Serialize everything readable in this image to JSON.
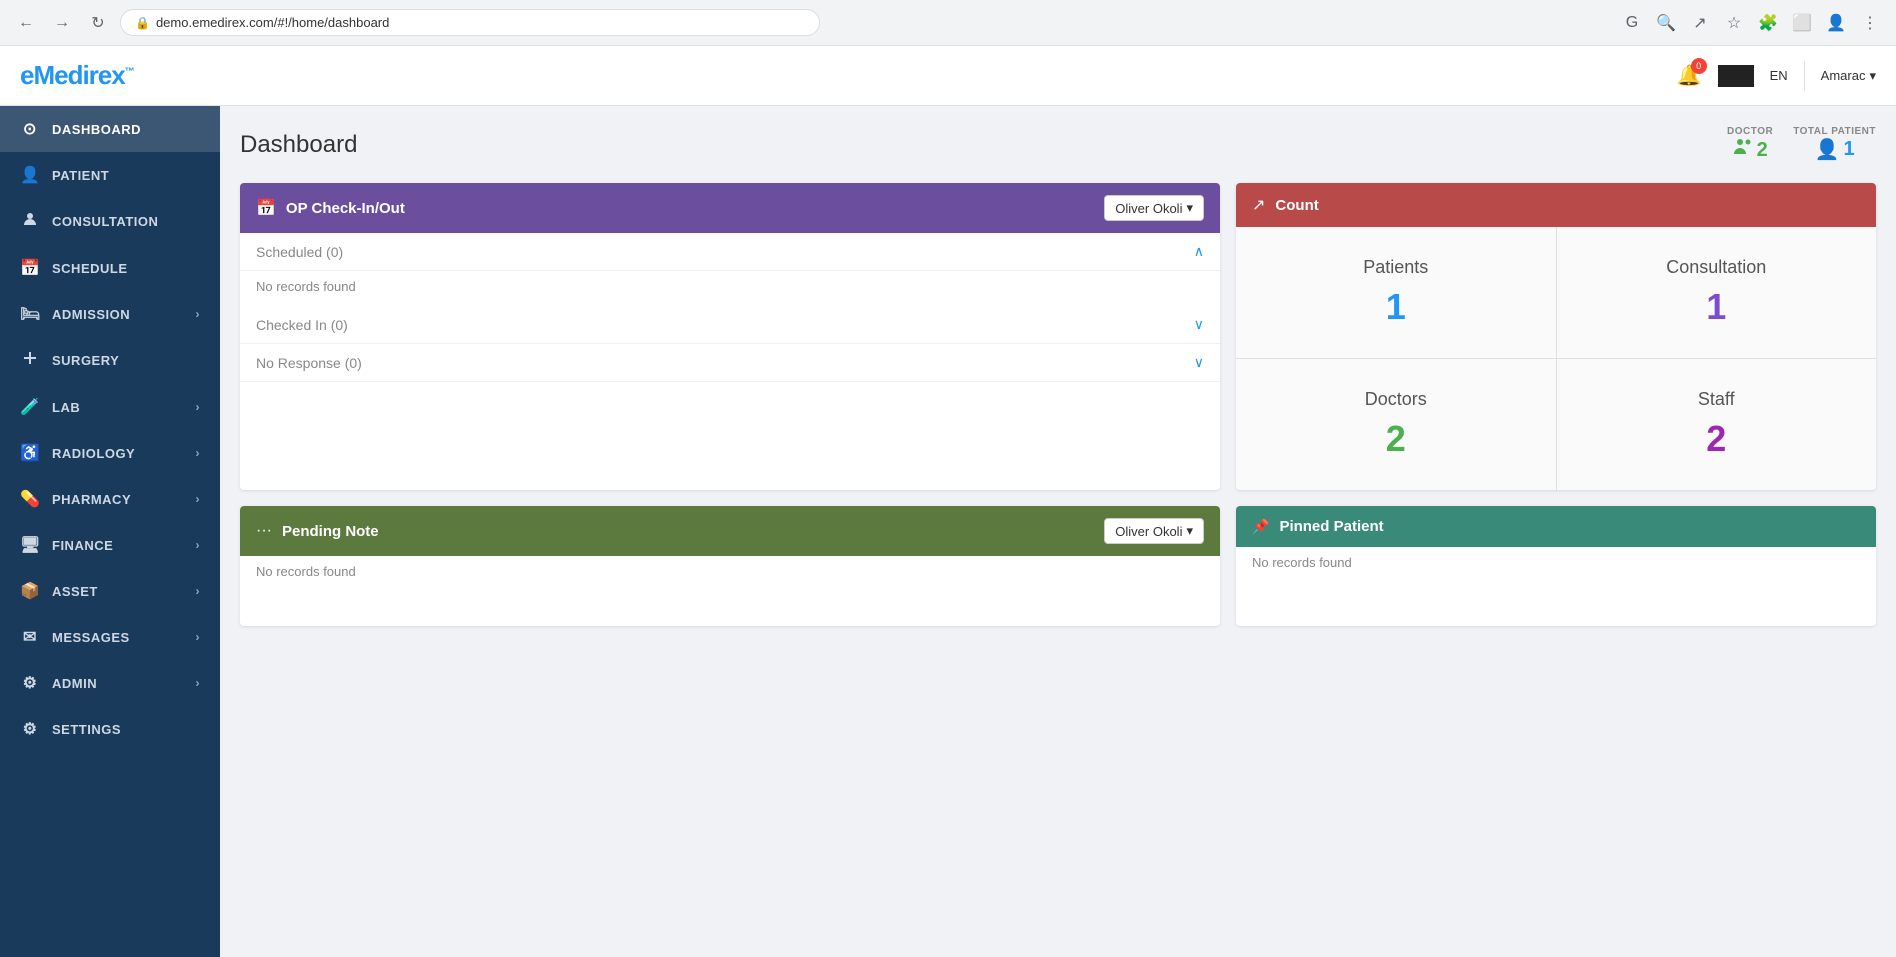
{
  "browser": {
    "url": "demo.emedirex.com/#!/home/dashboard",
    "nav": {
      "back": "←",
      "forward": "→",
      "reload": "↻"
    }
  },
  "header": {
    "logo": "eMedirex",
    "logo_tm": "™",
    "notification_count": "0",
    "language": "EN",
    "user": "Amarac"
  },
  "sidebar": {
    "items": [
      {
        "id": "dashboard",
        "label": "DASHBOARD",
        "icon": "⊙",
        "hasChevron": false,
        "active": true
      },
      {
        "id": "patient",
        "label": "PATIENT",
        "icon": "👤",
        "hasChevron": false,
        "active": false
      },
      {
        "id": "consultation",
        "label": "CONSULTATION",
        "icon": "👤",
        "hasChevron": false,
        "active": false
      },
      {
        "id": "schedule",
        "label": "SCHEDULE",
        "icon": "📅",
        "hasChevron": false,
        "active": false
      },
      {
        "id": "admission",
        "label": "ADMISSION",
        "icon": "🛏",
        "hasChevron": true,
        "active": false
      },
      {
        "id": "surgery",
        "label": "SURGERY",
        "icon": "🔧",
        "hasChevron": false,
        "active": false
      },
      {
        "id": "lab",
        "label": "LAB",
        "icon": "🧪",
        "hasChevron": true,
        "active": false
      },
      {
        "id": "radiology",
        "label": "RADIOLOGY",
        "icon": "♿",
        "hasChevron": true,
        "active": false
      },
      {
        "id": "pharmacy",
        "label": "PHARMACY",
        "icon": "💊",
        "hasChevron": true,
        "active": false
      },
      {
        "id": "finance",
        "label": "FINANCE",
        "icon": "🖥",
        "hasChevron": true,
        "active": false
      },
      {
        "id": "asset",
        "label": "ASSET",
        "icon": "📦",
        "hasChevron": true,
        "active": false
      },
      {
        "id": "messages",
        "label": "MESSAGES",
        "icon": "✉",
        "hasChevron": true,
        "active": false
      },
      {
        "id": "admin",
        "label": "ADMIN",
        "icon": "⚙",
        "hasChevron": true,
        "active": false
      },
      {
        "id": "settings",
        "label": "SETTINGS",
        "icon": "⚙",
        "hasChevron": false,
        "active": false
      }
    ]
  },
  "dashboard": {
    "title": "Dashboard",
    "stats": {
      "doctor_label": "DOCTOR",
      "doctor_value": "2",
      "patient_label": "TOTAL PATIENT",
      "patient_value": "1"
    },
    "op_checkin": {
      "header": "OP Check-In/Out",
      "doctor_select": "Oliver Okoli",
      "sections": [
        {
          "label": "Scheduled (0)",
          "open": true,
          "no_records": "No records found"
        },
        {
          "label": "Checked In (0)",
          "open": false
        },
        {
          "label": "No Response (0)",
          "open": false
        }
      ]
    },
    "count": {
      "header": "Count",
      "cells": [
        {
          "label": "Patients",
          "value": "1",
          "color": "blue"
        },
        {
          "label": "Consultation",
          "value": "1",
          "color": "purple"
        },
        {
          "label": "Doctors",
          "value": "2",
          "color": "green"
        },
        {
          "label": "Staff",
          "value": "2",
          "color": "violet"
        }
      ]
    },
    "pending_note": {
      "header": "Pending Note",
      "doctor_select": "Oliver Okoli",
      "no_records": "No records found"
    },
    "pinned_patient": {
      "header": "Pinned Patient",
      "no_records": "No records found"
    }
  }
}
